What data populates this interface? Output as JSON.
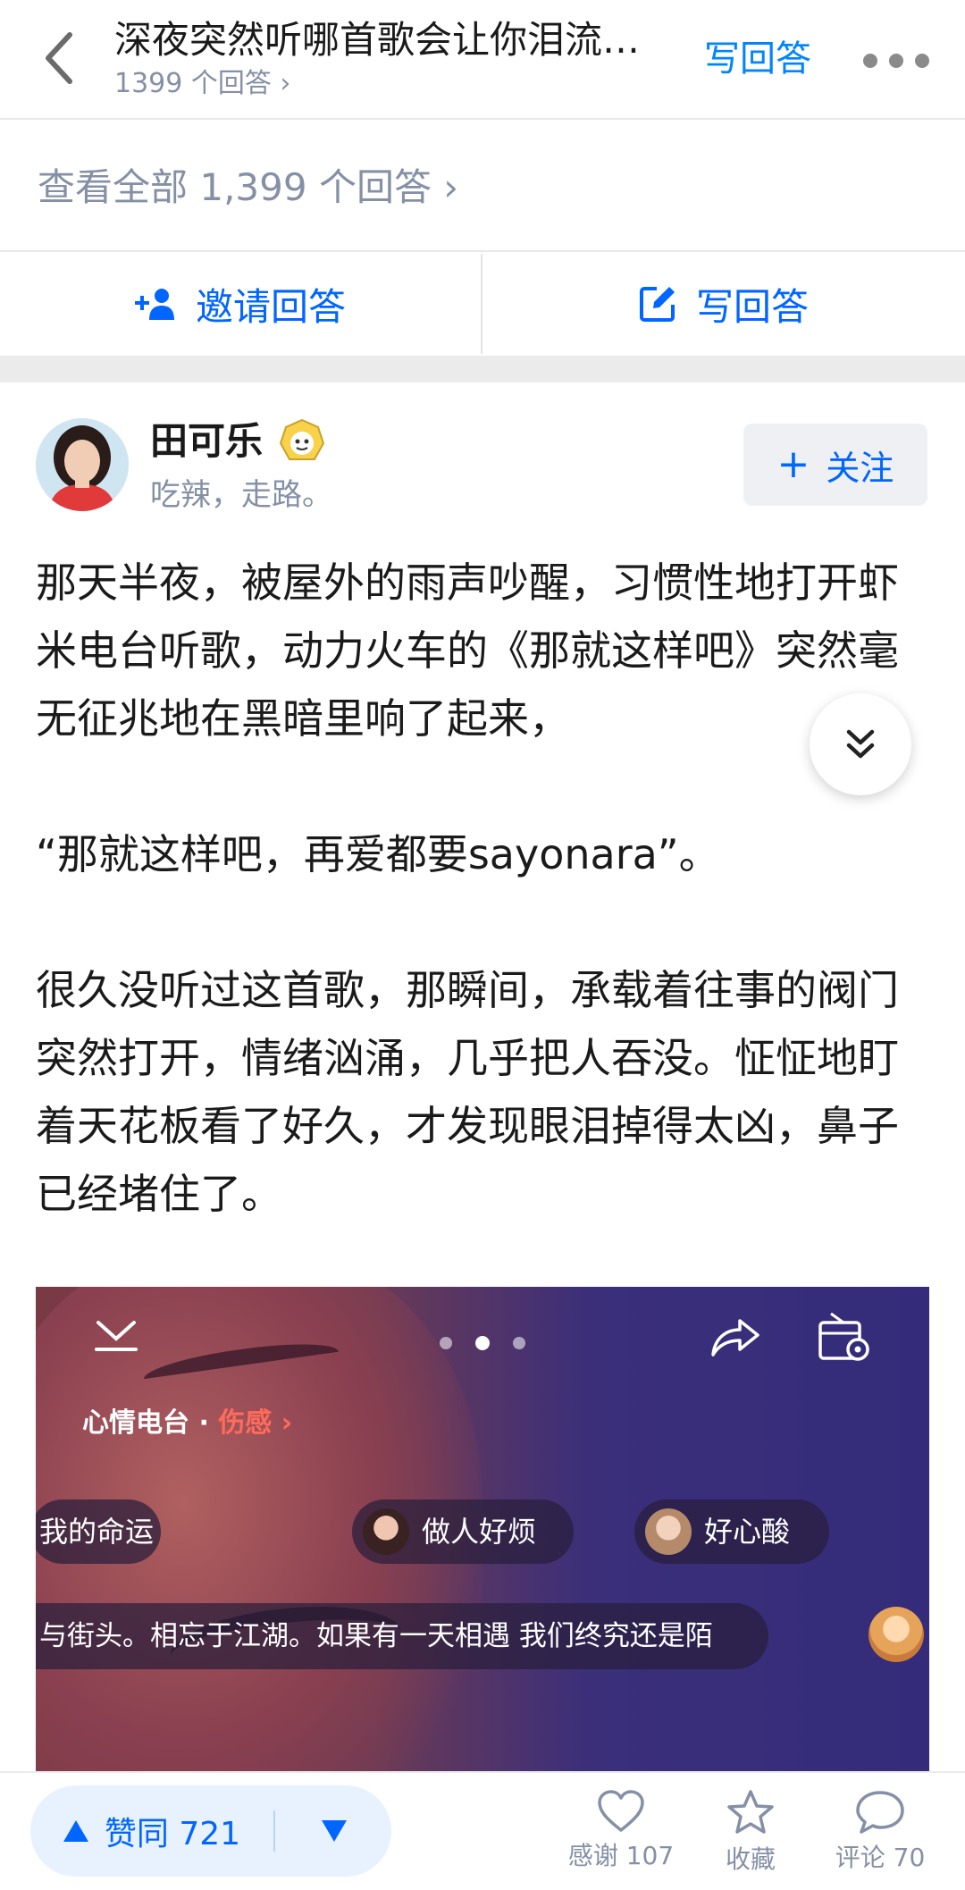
{
  "header": {
    "title": "深夜突然听哪首歌会让你泪流…",
    "subtitle": "1399 个回答 ›",
    "write_label": "写回答"
  },
  "view_all": "查看全部 1,399 个回答 ›",
  "actions": {
    "invite_label": "邀请回答",
    "write_label": "写回答"
  },
  "author": {
    "name": "田可乐",
    "bio": "吃辣，走路。",
    "follow_label": "关注"
  },
  "answer": {
    "p1": "那天半夜，被屋外的雨声吵醒，习惯性地打开虾米电台听歌，动力火车的《那就这样吧》突然毫无征兆地在黑暗里响了起来，",
    "p2": "“那就这样吧，再爱都要sayonara”。",
    "p3": "很久没听过这首歌，那瞬间，承载着往事的阀门突然打开，情绪汹涌，几乎把人吞没。怔怔地盯着天花板看了好久，才发现眼泪掉得太凶，鼻子已经堵住了。"
  },
  "embedded_screenshot": {
    "mood_label": "心情电台 · ",
    "mood_tag": "伤感 ›",
    "pill1": "我的命运",
    "pill2": "做人好烦",
    "pill3": "好心酸",
    "lyric": "与街头。相忘于江湖。如果有一天相遇 我们终究还是陌"
  },
  "bottom": {
    "upvote_label": "赞同 721",
    "thanks_label": "感谢 107",
    "favorite_label": "收藏",
    "comment_label": "评论 70"
  },
  "colors": {
    "accent": "#0066ff",
    "muted": "#8590a6",
    "vote_bg": "#e8f2ff"
  }
}
